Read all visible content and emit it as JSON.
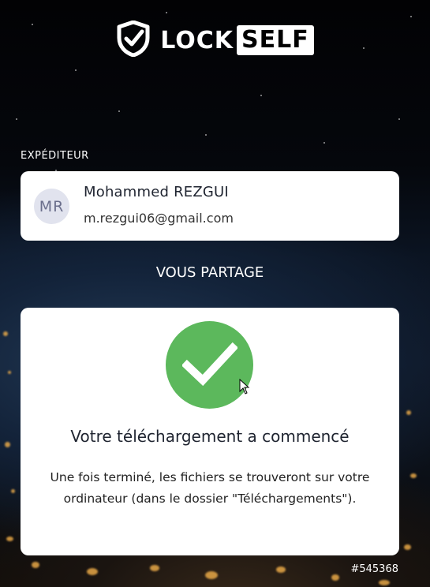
{
  "brand": {
    "name_part1": "LOCK",
    "name_part2": "SELF",
    "logo_icon": "shield-check-icon"
  },
  "sender_section": {
    "label": "EXPÉDITEUR",
    "avatar_initials": "MR",
    "name": "Mohammed REZGUI",
    "email": "m.rezgui06@gmail.com"
  },
  "share_section": {
    "label": "VOUS PARTAGE"
  },
  "status": {
    "icon": "checkmark-icon",
    "title": "Votre téléchargement a commencé",
    "message": "Une fois terminé, les fichiers se trouveront sur votre ordinateur (dans le dossier \"Téléchargements\")."
  },
  "footer": {
    "version": "#545368"
  },
  "colors": {
    "success": "#5cb85c",
    "card_bg": "#ffffff",
    "avatar_bg": "#e1e3ee"
  }
}
